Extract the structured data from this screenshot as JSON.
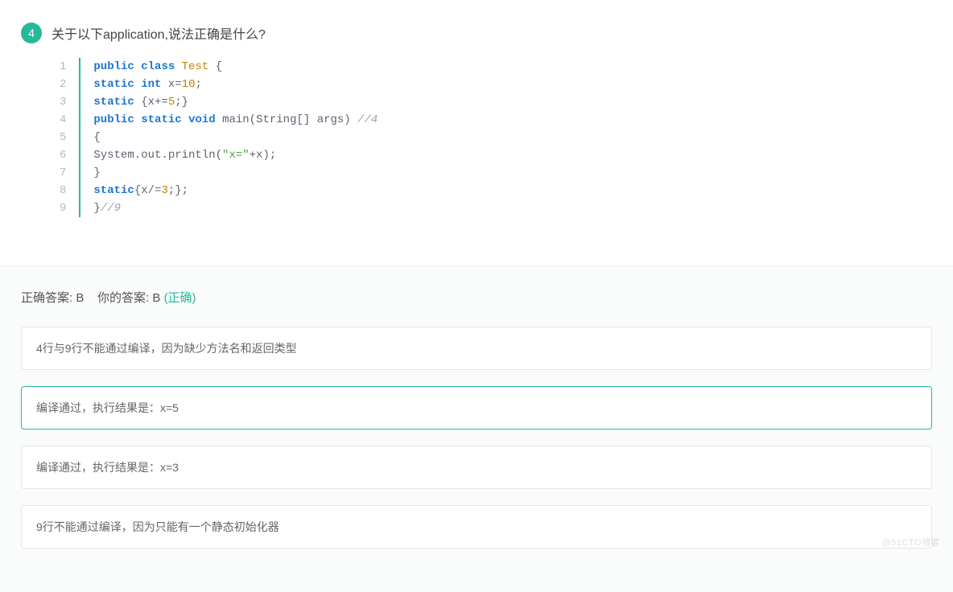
{
  "question": {
    "number": "4",
    "title": "关于以下application,说法正确是什么?"
  },
  "code": {
    "line_numbers": [
      "1",
      "2",
      "3",
      "4",
      "5",
      "6",
      "7",
      "8",
      "9"
    ],
    "lines": [
      {
        "tokens": [
          {
            "t": "public",
            "c": "kw"
          },
          {
            "t": " ",
            "c": "pln"
          },
          {
            "t": "class",
            "c": "kw"
          },
          {
            "t": " ",
            "c": "pln"
          },
          {
            "t": "Test",
            "c": "cls"
          },
          {
            "t": " {",
            "c": "pln"
          }
        ]
      },
      {
        "tokens": [
          {
            "t": "    ",
            "c": "pln"
          },
          {
            "t": "static",
            "c": "kw"
          },
          {
            "t": " ",
            "c": "pln"
          },
          {
            "t": "int",
            "c": "kw"
          },
          {
            "t": " x=",
            "c": "pln"
          },
          {
            "t": "10",
            "c": "num"
          },
          {
            "t": ";",
            "c": "pln"
          }
        ]
      },
      {
        "tokens": [
          {
            "t": "    ",
            "c": "pln"
          },
          {
            "t": "static",
            "c": "kw"
          },
          {
            "t": " {x+=",
            "c": "pln"
          },
          {
            "t": "5",
            "c": "num"
          },
          {
            "t": ";}",
            "c": "pln"
          }
        ]
      },
      {
        "tokens": [
          {
            "t": "    ",
            "c": "pln"
          },
          {
            "t": "public",
            "c": "kw"
          },
          {
            "t": " ",
            "c": "pln"
          },
          {
            "t": "static",
            "c": "kw"
          },
          {
            "t": " ",
            "c": "pln"
          },
          {
            "t": "void",
            "c": "kw"
          },
          {
            "t": " main(String[] args) ",
            "c": "pln"
          },
          {
            "t": "//4",
            "c": "com"
          }
        ]
      },
      {
        "tokens": [
          {
            "t": "        {",
            "c": "pln"
          }
        ]
      },
      {
        "tokens": [
          {
            "t": "        System.out.println(",
            "c": "pln"
          },
          {
            "t": "\"x=\"",
            "c": "str"
          },
          {
            "t": "+x);",
            "c": "pln"
          }
        ]
      },
      {
        "tokens": [
          {
            "t": "    }",
            "c": "pln"
          }
        ]
      },
      {
        "tokens": [
          {
            "t": "    ",
            "c": "pln"
          },
          {
            "t": "static",
            "c": "kw"
          },
          {
            "t": "{x/=",
            "c": "pln"
          },
          {
            "t": "3",
            "c": "num"
          },
          {
            "t": ";};",
            "c": "pln"
          }
        ]
      },
      {
        "tokens": [
          {
            "t": "}",
            "c": "pln"
          },
          {
            "t": "//9",
            "c": "com"
          }
        ]
      }
    ]
  },
  "answer": {
    "correct_prefix": "正确答案: ",
    "correct_value": "B",
    "your_prefix": "你的答案: ",
    "your_value": "B",
    "status": "(正确)"
  },
  "options": [
    {
      "text": "4行与9行不能通过编译，因为缺少方法名和返回类型",
      "selected": false
    },
    {
      "text": "编译通过，执行结果是：x=5",
      "selected": true
    },
    {
      "text": "编译通过，执行结果是：x=3",
      "selected": false
    },
    {
      "text": "9行不能通过编译，因为只能有一个静态初始化器",
      "selected": false
    }
  ],
  "watermark": "@51CTO博客"
}
